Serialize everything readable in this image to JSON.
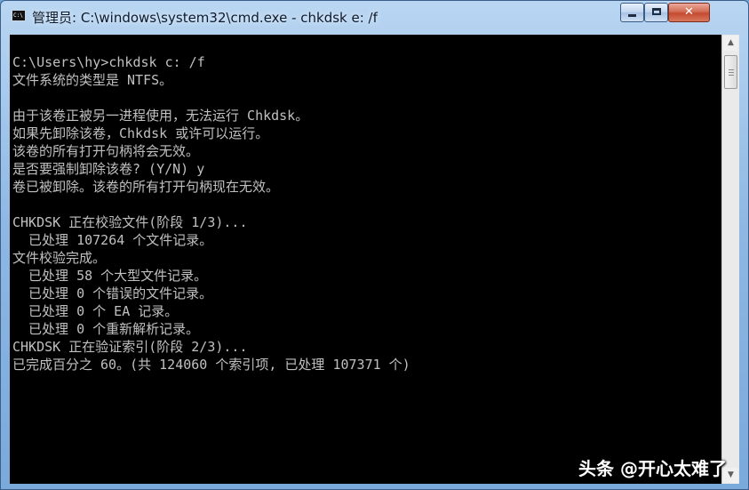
{
  "window": {
    "title": "管理员: C:\\windows\\system32\\cmd.exe - chkdsk  e: /f",
    "icon": "cmd-console-icon",
    "icon_text": "C:\\",
    "controls": {
      "minimize": "minimize-icon",
      "maximize": "maximize-icon",
      "close": "close-icon",
      "close_glyph": "✕"
    }
  },
  "console": {
    "background": "#000000",
    "foreground": "#c0c0c0",
    "lines": [
      "C:\\Users\\hy>chkdsk c: /f",
      "文件系统的类型是 NTFS。",
      "",
      "由于该卷正被另一进程使用，无法运行 Chkdsk。",
      "如果先卸除该卷，Chkdsk 或许可以运行。",
      "该卷的所有打开句柄将会无效。",
      "是否要强制卸除该卷? (Y/N) y",
      "卷已被卸除。该卷的所有打开句柄现在无效。",
      "",
      "CHKDSK 正在校验文件(阶段 1/3)...",
      "  已处理 107264 个文件记录。",
      "文件校验完成。",
      "  已处理 58 个大型文件记录。",
      "  已处理 0 个错误的文件记录。",
      "  已处理 0 个 EA 记录。",
      "  已处理 0 个重新解析记录。",
      "CHKDSK 正在验证索引(阶段 2/3)...",
      "已完成百分之 60。(共 124060 个索引项, 已处理 107371 个)"
    ]
  },
  "scrollbar": {
    "up_arrow": "▲",
    "down_arrow": "▼"
  },
  "watermark": {
    "text": "头条 @开心太难了"
  }
}
